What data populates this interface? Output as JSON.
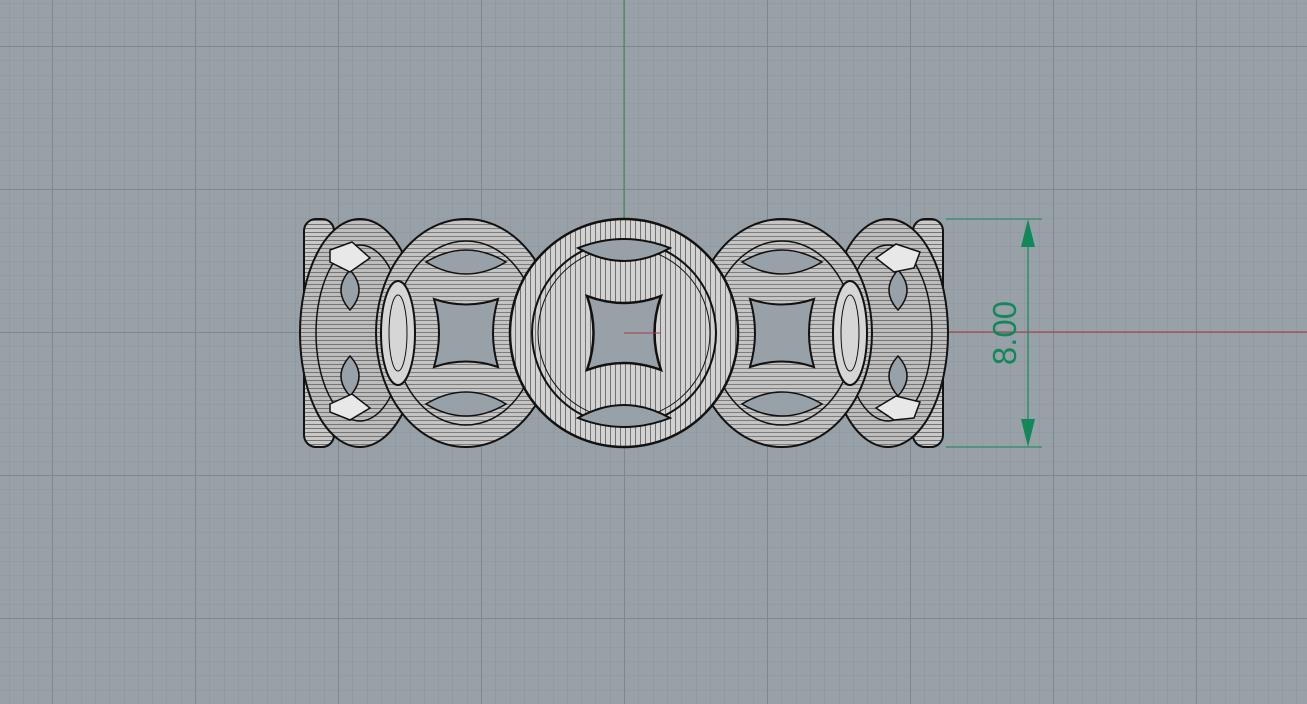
{
  "viewport": {
    "view": "front",
    "display_mode": "wireframe",
    "background_color": "#98a0a8",
    "grid": {
      "visible": true,
      "minor_color": "#8d959d",
      "major_color": "#7f878f"
    },
    "axes": {
      "x_axis_color": "#b0393c",
      "y_axis_color": "#2f8f4a"
    }
  },
  "model": {
    "object": "ring",
    "wire_color": "#141414",
    "highlight_color": "#f2f2f2"
  },
  "dimension": {
    "label": "8.00",
    "color": "#12885a"
  }
}
